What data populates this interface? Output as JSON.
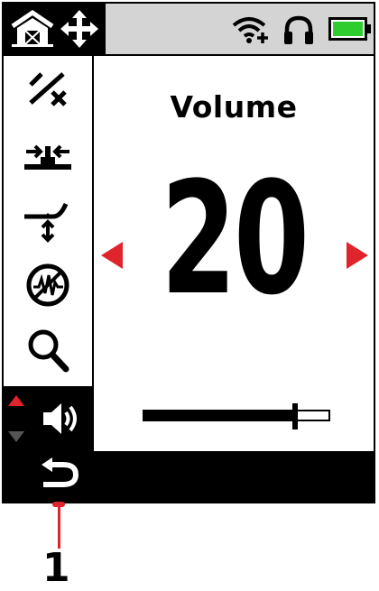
{
  "topbar": {
    "mode_icon": "farm-house-icon",
    "pan_icon": "move-arrows-icon",
    "status_icons": [
      "wifi-plus-icon",
      "headphones-icon",
      "battery-icon"
    ],
    "battery_color": "#2ecc2e"
  },
  "sidebar": {
    "items": [
      {
        "icon": "ground-balance-icon"
      },
      {
        "icon": "sensitivity-icon"
      },
      {
        "icon": "depth-adjust-icon"
      },
      {
        "icon": "noise-cancel-icon"
      },
      {
        "icon": "search-icon"
      },
      {
        "icon": "volume-icon",
        "active": true
      }
    ]
  },
  "main": {
    "title": "Volume",
    "value": "20",
    "slider_level": 0.82,
    "accent_color": "#e0242b"
  },
  "bottombar": {
    "back_icon": "back-arrow-icon"
  },
  "callout": {
    "label": "1"
  }
}
